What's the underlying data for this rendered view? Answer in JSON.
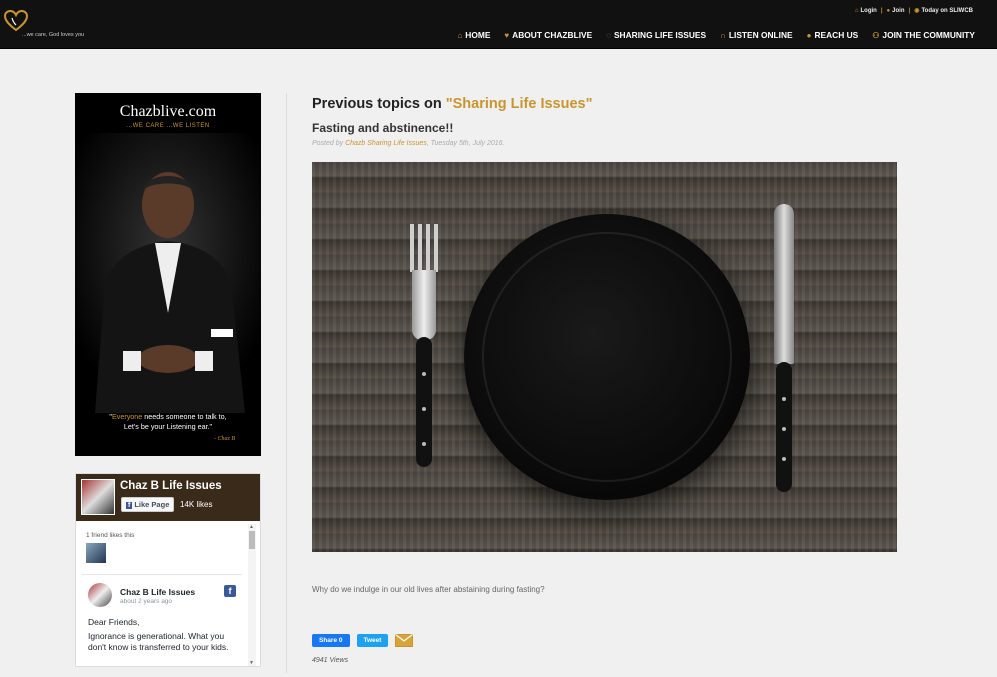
{
  "site": {
    "tagline": "...we care, God loves you"
  },
  "top_links": [
    {
      "label": "Login",
      "icon": "home-icon"
    },
    {
      "label": "Join",
      "icon": "user-icon"
    },
    {
      "label": "Today on SLIWCB",
      "icon": "chat-icon"
    }
  ],
  "nav": [
    {
      "label": "HOME",
      "icon": "home-icon"
    },
    {
      "label": "ABOUT CHAZBLIVE",
      "icon": "heart-icon"
    },
    {
      "label": "SHARING LIFE ISSUES",
      "icon": "chat-icon"
    },
    {
      "label": "LISTEN ONLINE",
      "icon": "headphones-icon"
    },
    {
      "label": "REACH US",
      "icon": "help-icon"
    },
    {
      "label": "JOIN THE COMMUNITY",
      "icon": "users-icon"
    }
  ],
  "promo": {
    "title": "Chazblive.com",
    "subtitle": "...WE CARE ...WE LISTEN",
    "quote_highlight": "Everyone",
    "quote_rest": " needs someone to talk to,",
    "quote_line2": "Let's be your Listening ear.\"",
    "signature": "- Chaz B"
  },
  "facebook": {
    "page_name": "Chaz B Life Issues",
    "like_label": "Like Page",
    "like_count": "14K likes",
    "friends_text": "1 friend likes this",
    "post": {
      "author": "Chaz B Life Issues",
      "time": "about 2 years ago",
      "greeting": "Dear Friends,",
      "body": "Ignorance is generational. What you don't know is transferred to your kids."
    }
  },
  "main": {
    "heading_prefix": "Previous topics on ",
    "heading_accent": "\"Sharing Life Issues\"",
    "post_title": "Fasting and abstinence!!",
    "meta_prefix": "Posted by ",
    "meta_author": "Chazb Sharing Life Issues",
    "meta_date": ", Tuesday 5th, July 2016.",
    "excerpt": "Why do we indulge in our old lives after abstaining during fasting?",
    "share_label": "Share 0",
    "tweet_label": "Tweet",
    "views": "4941 Views"
  },
  "colors": {
    "accent": "#c8952f",
    "nav_bg": "#111111",
    "page_bg": "#f0f0f0"
  }
}
